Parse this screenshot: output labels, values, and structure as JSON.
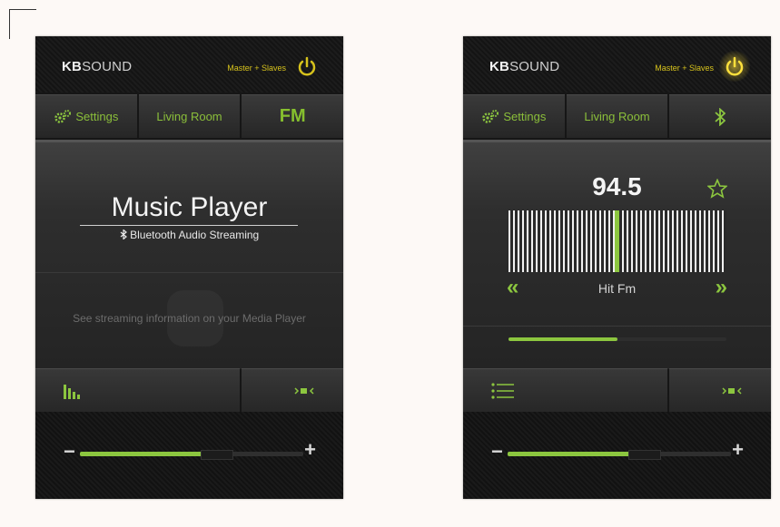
{
  "colors": {
    "accent": "#8cc63f",
    "power": "#d6c21c",
    "text": "#f4f4f4"
  },
  "left_panel": {
    "brand_bold": "KB",
    "brand_rest": "SOUND",
    "master_label": "Master + Slaves",
    "tabs": {
      "settings_label": "Settings",
      "room_label": "Living Room",
      "source_label": "FM"
    },
    "main": {
      "title": "Music Player",
      "subtitle": "Bluetooth Audio Streaming",
      "info": "See streaming information on your Media Player"
    },
    "bottom": {
      "left_icon": "equalizer-icon",
      "right_icon": "speaker-link-icon"
    },
    "volume": {
      "level": 0.55
    }
  },
  "right_panel": {
    "brand_bold": "KB",
    "brand_rest": "SOUND",
    "master_label": "Master + Slaves",
    "power_active": true,
    "tabs": {
      "settings_label": "Settings",
      "room_label": "Living Room",
      "source_icon": "bluetooth-icon"
    },
    "fm": {
      "frequency": "94.5",
      "station": "Hit Fm",
      "prev_label": "«",
      "next_label": "»",
      "tuner_position": 0.5,
      "signal_level": 0.5
    },
    "bottom": {
      "left_icon": "presets-list-icon",
      "right_icon": "speaker-link-icon"
    },
    "volume": {
      "level": 0.55
    }
  }
}
